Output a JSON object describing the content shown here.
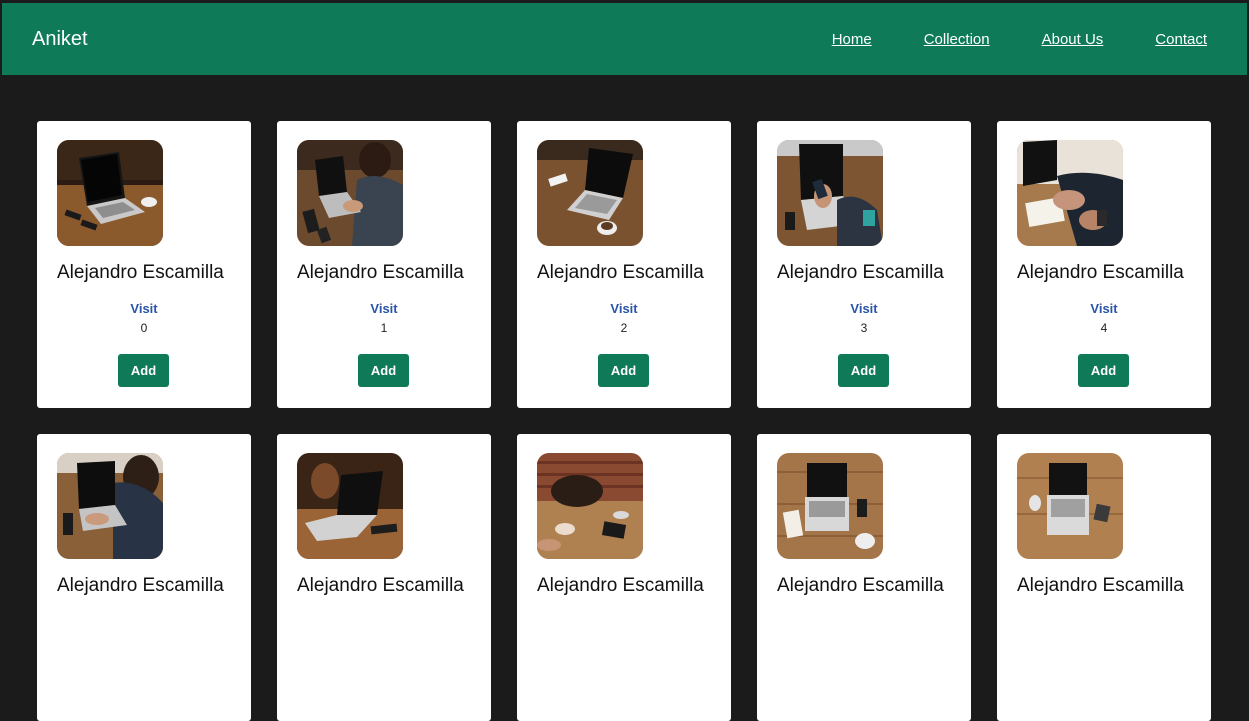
{
  "navbar": {
    "brand": "Aniket",
    "links": [
      "Home",
      "Collection",
      "About Us",
      "Contact"
    ],
    "bg_color": "#0e7a57"
  },
  "cards": [
    {
      "title": "Alejandro Escamilla",
      "link": "Visit",
      "index": "0",
      "button": "Add",
      "image": "laptop-on-desk-photo"
    },
    {
      "title": "Alejandro Escamilla",
      "link": "Visit",
      "index": "1",
      "button": "Add",
      "image": "person-using-laptop-photo"
    },
    {
      "title": "Alejandro Escamilla",
      "link": "Visit",
      "index": "2",
      "button": "Add",
      "image": "laptop-with-coffee-photo"
    },
    {
      "title": "Alejandro Escamilla",
      "link": "Visit",
      "index": "3",
      "button": "Add",
      "image": "laptop-with-phone-photo"
    },
    {
      "title": "Alejandro Escamilla",
      "link": "Visit",
      "index": "4",
      "button": "Add",
      "image": "hands-writing-photo"
    },
    {
      "title": "Alejandro Escamilla",
      "image": "typing-on-laptop-photo"
    },
    {
      "title": "Alejandro Escamilla",
      "image": "laptop-on-wooden-table-photo"
    },
    {
      "title": "Alejandro Escamilla",
      "image": "cafe-table-photo"
    },
    {
      "title": "Alejandro Escamilla",
      "image": "laptop-top-view-photo"
    },
    {
      "title": "Alejandro Escamilla",
      "image": "laptop-flatlay-photo"
    }
  ],
  "colors": {
    "accent": "#0e7a57",
    "page_bg": "#1b1b1b",
    "link": "#2a55a8"
  }
}
